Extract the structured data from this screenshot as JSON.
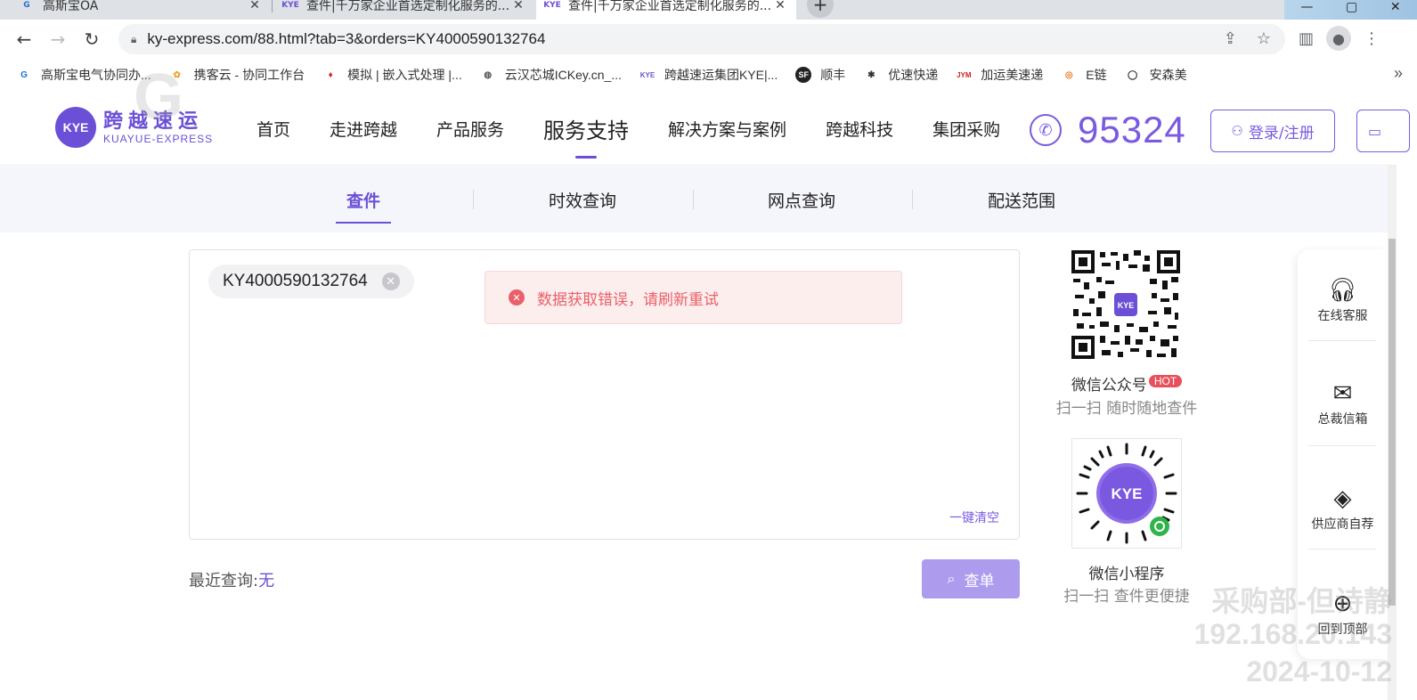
{
  "browser": {
    "tabs": [
      {
        "title": "高斯宝OA",
        "icon": "gaosibao-icon"
      },
      {
        "title": "查件|千万家企业首选定制化服务的...",
        "icon": "kye-icon"
      },
      {
        "title": "查件|千万家企业首选定制化服务的...",
        "icon": "kye-icon"
      }
    ],
    "url": "ky-express.com/88.html?tab=3&orders=KY4000590132764",
    "bookmarks": [
      {
        "label": "高斯宝电气协同办...",
        "icon": "gaosibao-icon"
      },
      {
        "label": "携客云 - 协同工作台",
        "icon": "xieke-icon"
      },
      {
        "label": "模拟 | 嵌入式处理 |...",
        "icon": "ti-icon"
      },
      {
        "label": "云汉芯城ICKey.cn_...",
        "icon": "globe-icon"
      },
      {
        "label": "跨越速运集团KYE|...",
        "icon": "kye-icon"
      },
      {
        "label": "顺丰",
        "icon": "sf-icon"
      },
      {
        "label": "优速快递",
        "icon": "uc-icon"
      },
      {
        "label": "加运美速递",
        "icon": "jiayunmei-icon"
      },
      {
        "label": "E链",
        "icon": "elian-icon"
      },
      {
        "label": "安森美",
        "icon": "onsemi-icon"
      }
    ],
    "more_bookmarks": "»"
  },
  "site": {
    "logo": {
      "mark": "KYE",
      "cn": "跨越速运",
      "en": "KUAYUE-EXPRESS"
    },
    "nav": [
      "首页",
      "走进跨越",
      "产品服务",
      "服务支持",
      "解决方案与案例",
      "跨越科技",
      "集团采购"
    ],
    "active_nav": "服务支持",
    "hotline": "95324",
    "login_label": "登录/注册"
  },
  "subtabs": [
    "查件",
    "时效查询",
    "网点查询",
    "配送范围"
  ],
  "query": {
    "order_chip": "KY4000590132764",
    "clear_all": "一键清空",
    "error_message": "数据获取错误，请刷新重试",
    "recent_label": "最近查询:",
    "recent_value": "无",
    "search_button": "查单"
  },
  "qr": {
    "wechat_official": {
      "caption": "微信公众号",
      "badge": "HOT",
      "sub": "扫一扫 随时随地查件",
      "center_label": "KYE"
    },
    "mini_program": {
      "caption": "微信小程序",
      "sub": "扫一扫 查件更便捷",
      "center_label": "KYE"
    }
  },
  "side_tools": [
    {
      "label": "在线客服",
      "icon": "headset-icon"
    },
    {
      "label": "总裁信箱",
      "icon": "mailbox-icon"
    },
    {
      "label": "供应商自荐",
      "icon": "handshake-icon"
    },
    {
      "label": "回到顶部",
      "icon": "arrow-up-circle-icon"
    }
  ],
  "watermark": {
    "line1": "采购部-但诗静",
    "line2": "192.168.20.143",
    "line3": "2024-10-12"
  },
  "colors": {
    "brand": "#6b4fd6",
    "error": "#e8616a",
    "button": "#ad9cee"
  }
}
